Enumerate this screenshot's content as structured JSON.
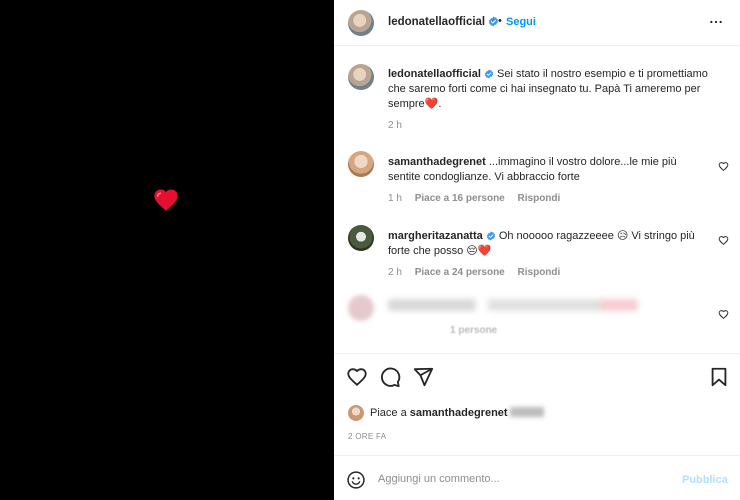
{
  "header": {
    "username": "ledonatellaofficial",
    "separator": "•",
    "follow_label": "Segui"
  },
  "caption": {
    "username": "ledonatellaofficial",
    "text": "Sei stato il nostro esempio e ti promettiamo che saremo forti come ci hai insegnato tu. Papà Ti ameremo per sempre",
    "emoji": "❤️",
    "time": "2 h"
  },
  "comments": [
    {
      "username": "samanthadegrenet",
      "text": "...immagino il vostro dolore...le mie più sentite condoglianze. Vi abbraccio forte",
      "time": "1 h",
      "likes": "Piace a 16 persone",
      "reply": "Rispondi"
    },
    {
      "username": "margheritazanatta",
      "text": "Oh nooooo ragazzeeee",
      "text_after": "Vi stringo più forte che posso",
      "emoji_1": "😥",
      "emoji_2": "😔❤️",
      "time": "2 h",
      "likes": "Piace a 24 persone",
      "reply": "Rispondi"
    },
    {
      "meta_partial": "1 persone"
    }
  ],
  "likes": {
    "prefix": "Piace a",
    "username": "samanthadegrenet"
  },
  "post_time": "2 ORE FA",
  "add_comment": {
    "placeholder": "Aggiungi un commento...",
    "publish_label": "Pubblica"
  },
  "colors": {
    "accent": "#0095f6",
    "verified": "#3897f0",
    "heart": "#ed4956",
    "publish_disabled": "#b2dffc"
  },
  "icons": {
    "media_heart": "red-heart-icon",
    "verified": "verified-badge-icon",
    "more": "more-options-icon",
    "like": "heart-outline-icon",
    "comment": "comment-bubble-icon",
    "share": "paper-plane-icon",
    "save": "bookmark-icon",
    "emoji": "smiley-icon"
  }
}
